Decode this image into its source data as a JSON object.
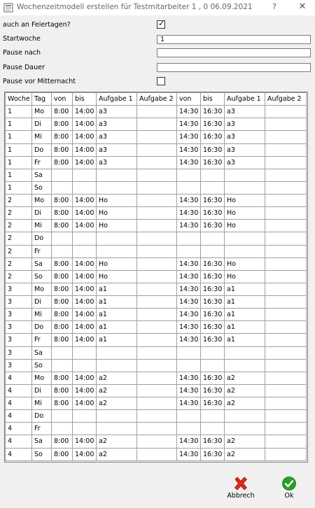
{
  "window": {
    "title": "Wochenzeitmodell erstellen für Testmitarbeiter 1 , 0 06.09.2021",
    "help_label": "?",
    "close_label": "✕"
  },
  "form": {
    "holidays_label": "auch an Feiertagen?",
    "holidays_checked": true,
    "start_week_label": "Startwoche",
    "start_week_value": "1",
    "pause_after_label": "Pause nach",
    "pause_after_value": "",
    "pause_duration_label": "Pause Dauer",
    "pause_duration_value": "",
    "pause_midnight_label": "Pause vor Mitternacht",
    "pause_midnight_checked": false
  },
  "table": {
    "headers": [
      "Woche",
      "Tag",
      "von",
      "bis",
      "Aufgabe 1",
      "Aufgabe 2",
      "von",
      "bis",
      "Aufgabe 1",
      "Aufgabe 2"
    ],
    "rows": [
      [
        "1",
        "Mo",
        "8:00",
        "14:00",
        "a3",
        "",
        "14:30",
        "16:30",
        "a3",
        ""
      ],
      [
        "1",
        "Di",
        "8:00",
        "14:00",
        "a3",
        "",
        "14:30",
        "16:30",
        "a3",
        ""
      ],
      [
        "1",
        "Mi",
        "8:00",
        "14:00",
        "a3",
        "",
        "14:30",
        "16:30",
        "a3",
        ""
      ],
      [
        "1",
        "Do",
        "8:00",
        "14:00",
        "a3",
        "",
        "14:30",
        "16:30",
        "a3",
        ""
      ],
      [
        "1",
        "Fr",
        "8:00",
        "14:00",
        "a3",
        "",
        "14:30",
        "16:30",
        "a3",
        ""
      ],
      [
        "1",
        "Sa",
        "",
        "",
        "",
        "",
        "",
        "",
        "",
        ""
      ],
      [
        "1",
        "So",
        "",
        "",
        "",
        "",
        "",
        "",
        "",
        ""
      ],
      [
        "2",
        "Mo",
        "8:00",
        "14:00",
        "Ho",
        "",
        "14:30",
        "16:30",
        "Ho",
        ""
      ],
      [
        "2",
        "Di",
        "8:00",
        "14:00",
        "Ho",
        "",
        "14:30",
        "16:30",
        "Ho",
        ""
      ],
      [
        "2",
        "Mi",
        "8:00",
        "14:00",
        "Ho",
        "",
        "14:30",
        "16:30",
        "Ho",
        ""
      ],
      [
        "2",
        "Do",
        "",
        "",
        "",
        "",
        "",
        "",
        "",
        ""
      ],
      [
        "2",
        "Fr",
        "",
        "",
        "",
        "",
        "",
        "",
        "",
        ""
      ],
      [
        "2",
        "Sa",
        "8:00",
        "14:00",
        "Ho",
        "",
        "14:30",
        "16:30",
        "Ho",
        ""
      ],
      [
        "2",
        "So",
        "8:00",
        "14:00",
        "Ho",
        "",
        "14:30",
        "16:30",
        "Ho",
        ""
      ],
      [
        "3",
        "Mo",
        "8:00",
        "14:00",
        "a1",
        "",
        "14:30",
        "16:30",
        "a1",
        ""
      ],
      [
        "3",
        "Di",
        "8:00",
        "14:00",
        "a1",
        "",
        "14:30",
        "16:30",
        "a1",
        ""
      ],
      [
        "3",
        "Mi",
        "8:00",
        "14:00",
        "a1",
        "",
        "14:30",
        "16:30",
        "a1",
        ""
      ],
      [
        "3",
        "Do",
        "8:00",
        "14:00",
        "a1",
        "",
        "14:30",
        "16:30",
        "a1",
        ""
      ],
      [
        "3",
        "Fr",
        "8:00",
        "14:00",
        "a1",
        "",
        "14:30",
        "16:30",
        "a1",
        ""
      ],
      [
        "3",
        "Sa",
        "",
        "",
        "",
        "",
        "",
        "",
        "",
        ""
      ],
      [
        "3",
        "So",
        "",
        "",
        "",
        "",
        "",
        "",
        "",
        ""
      ],
      [
        "4",
        "Mo",
        "8:00",
        "14:00",
        "a2",
        "",
        "14:30",
        "16:30",
        "a2",
        ""
      ],
      [
        "4",
        "Di",
        "8:00",
        "14:00",
        "a2",
        "",
        "14:30",
        "16:30",
        "a2",
        ""
      ],
      [
        "4",
        "Mi",
        "8:00",
        "14:00",
        "a2",
        "",
        "14:30",
        "16:30",
        "a2",
        ""
      ],
      [
        "4",
        "Do",
        "",
        "",
        "",
        "",
        "",
        "",
        "",
        ""
      ],
      [
        "4",
        "Fr",
        "",
        "",
        "",
        "",
        "",
        "",
        "",
        ""
      ],
      [
        "4",
        "Sa",
        "8:00",
        "14:00",
        "a2",
        "",
        "14:30",
        "16:30",
        "a2",
        ""
      ],
      [
        "4",
        "So",
        "8:00",
        "14:00",
        "a2",
        "",
        "14:30",
        "16:30",
        "a2",
        ""
      ]
    ]
  },
  "buttons": {
    "cancel_label": "Abbrech",
    "ok_label": "Ok"
  },
  "colors": {
    "cancel_icon": "#e0281e",
    "ok_icon": "#2a9d2a"
  }
}
